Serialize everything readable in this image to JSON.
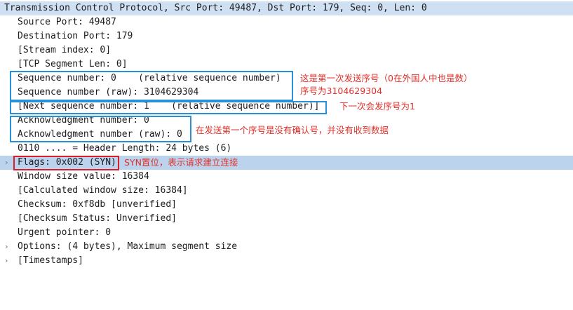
{
  "tree": {
    "header": "Transmission Control Protocol, Src Port: 49487, Dst Port: 179, Seq: 0, Len: 0",
    "rows": [
      {
        "text": "Source Port: 49487"
      },
      {
        "text": "Destination Port: 179"
      },
      {
        "text": "[Stream index: 0]"
      },
      {
        "text": "[TCP Segment Len: 0]"
      },
      {
        "text": "Sequence number: 0    (relative sequence number)"
      },
      {
        "text": "Sequence number (raw): 3104629304"
      },
      {
        "text": "[Next sequence number: 1    (relative sequence number)]"
      },
      {
        "text": "Acknowledgment number: 0"
      },
      {
        "text": "Acknowledgment number (raw): 0"
      },
      {
        "text": "0110 .... = Header Length: 24 bytes (6)"
      },
      {
        "text": "Flags: 0x002 (SYN)"
      },
      {
        "text": "Window size value: 16384"
      },
      {
        "text": "[Calculated window size: 16384]"
      },
      {
        "text": "Checksum: 0xf8db [unverified]"
      },
      {
        "text": "[Checksum Status: Unverified]"
      },
      {
        "text": "Urgent pointer: 0"
      },
      {
        "text": "Options: (4 bytes), Maximum segment size"
      },
      {
        "text": "[Timestamps]"
      }
    ],
    "expander_glyph": "›"
  },
  "annotations": {
    "seq_note_line1": "这是第一次发送序号（0在外国人中也是数）",
    "seq_note_line2": "序号为3104629304",
    "next_seq_note": "下一次会发序号为1",
    "ack_note": "在发送第一个序号是没有确认号，并没有收到数据",
    "flags_note": "SYN置位，表示请求建立连接"
  },
  "colors": {
    "header_bg": "#cfe0f3",
    "selected_bg": "#bcd3ee",
    "annotation_box_blue": "#2a8fd4",
    "annotation_box_red": "#d9202a",
    "annotation_text": "#e0302a"
  }
}
